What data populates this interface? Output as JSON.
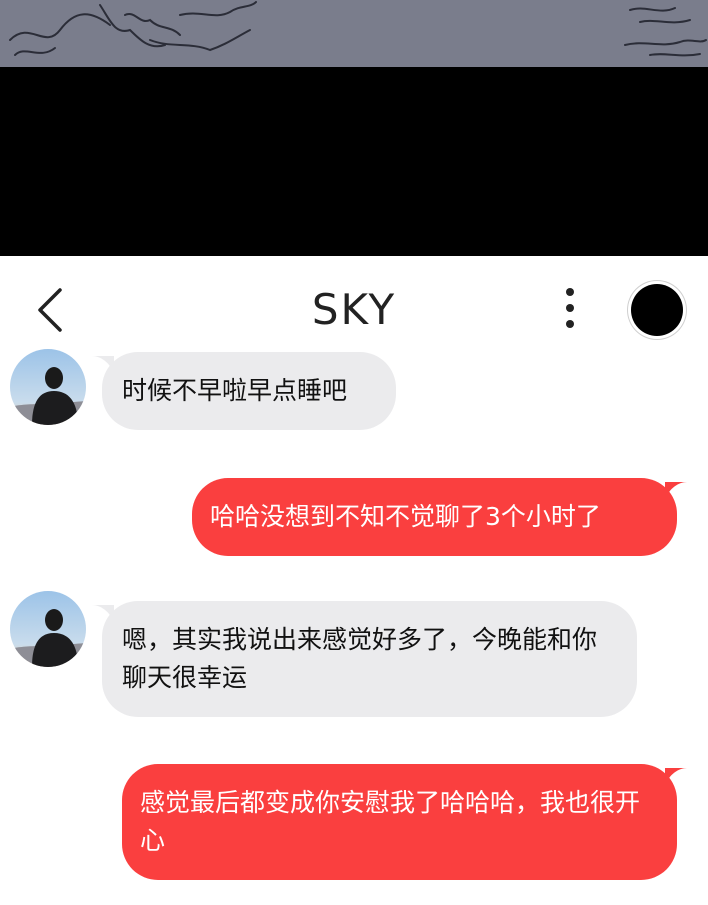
{
  "colors": {
    "incoming_bubble": "#ebebed",
    "outgoing_bubble": "#fa3f3f",
    "outgoing_text": "#ffffff",
    "incoming_text": "#111111"
  },
  "header": {
    "back_icon": "chevron-left-icon",
    "title": "SKY",
    "more_icon": "more-vertical-icon",
    "profile_icon": "profile-circle"
  },
  "messages": [
    {
      "side": "incoming",
      "text": "时候不早啦早点睡吧"
    },
    {
      "side": "outgoing",
      "text": "哈哈没想到不知不觉聊了3个小时了"
    },
    {
      "side": "incoming",
      "text": "嗯，其实我说出来感觉好多了，今晚能和你聊天很幸运"
    },
    {
      "side": "outgoing",
      "text": "感觉最后都变成你安慰我了哈哈哈，我也很开心"
    }
  ]
}
